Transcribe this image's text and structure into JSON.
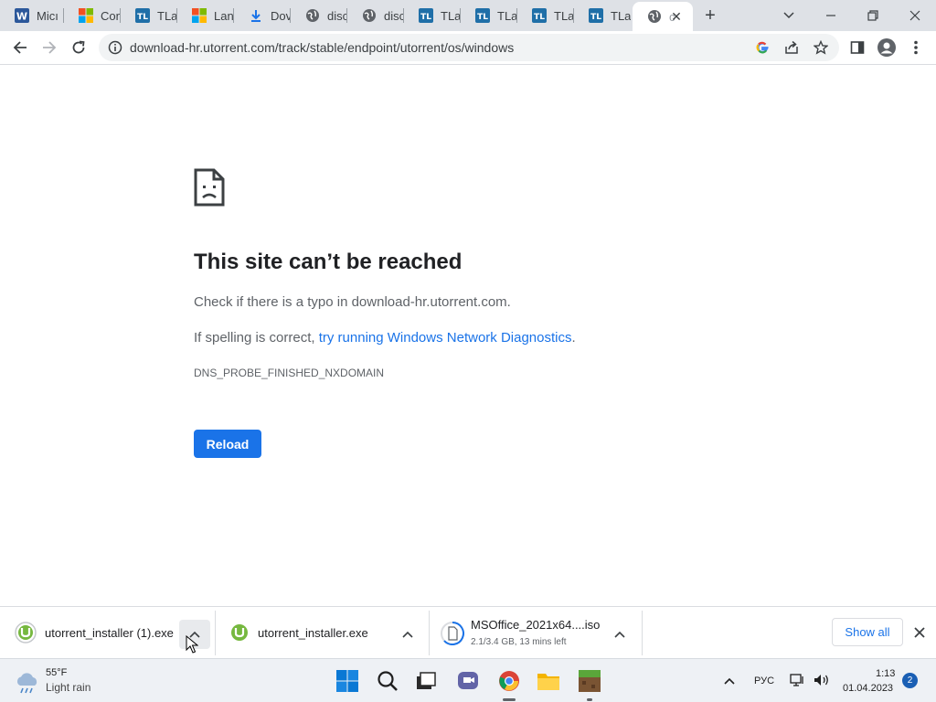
{
  "tabs": [
    {
      "title": "Micı",
      "icon": "word-icon"
    },
    {
      "title": "Con",
      "icon": "microsoft-icon"
    },
    {
      "title": "TLa",
      "icon": "tl-icon"
    },
    {
      "title": "Lanç",
      "icon": "microsoft-icon"
    },
    {
      "title": "Dov",
      "icon": "download-icon"
    },
    {
      "title": "disc",
      "icon": "globe-icon"
    },
    {
      "title": "disc",
      "icon": "globe-icon"
    },
    {
      "title": "TLa",
      "icon": "tl-icon"
    },
    {
      "title": "TLa",
      "icon": "tl-icon"
    },
    {
      "title": "TLa",
      "icon": "tl-icon"
    },
    {
      "title": "TLa",
      "icon": "tl-icon"
    },
    {
      "title": "c",
      "icon": "globe-icon",
      "active": true
    }
  ],
  "address_bar": {
    "url": "download-hr.utorrent.com/track/stable/endpoint/utorrent/os/windows"
  },
  "error_page": {
    "title": "This site can’t be reached",
    "check_text": "Check if there is a typo in download-hr.utorrent.com.",
    "spelling_prefix": "If spelling is correct, ",
    "diagnostics_link": "try running Windows Network Diagnostics",
    "spelling_suffix": ".",
    "error_code": "DNS_PROBE_FINISHED_NXDOMAIN",
    "reload_label": "Reload"
  },
  "downloads": [
    {
      "name": "utorrent_installer (1).exe",
      "status": ""
    },
    {
      "name": "utorrent_installer.exe",
      "status": ""
    },
    {
      "name": "MSOffice_2021x64....iso",
      "status": "2.1/3.4 GB, 13 mins left"
    }
  ],
  "download_shelf": {
    "show_all_label": "Show all"
  },
  "taskbar": {
    "weather_temp": "55°F",
    "weather_desc": "Light rain",
    "language": "РУС",
    "time": "1:13",
    "date": "01.04.2023",
    "notification_count": "2"
  },
  "colors": {
    "accent": "#1a73e8",
    "tabstrip": "#dee1e6",
    "error_title": "#202124",
    "text_secondary": "#5f6368"
  }
}
